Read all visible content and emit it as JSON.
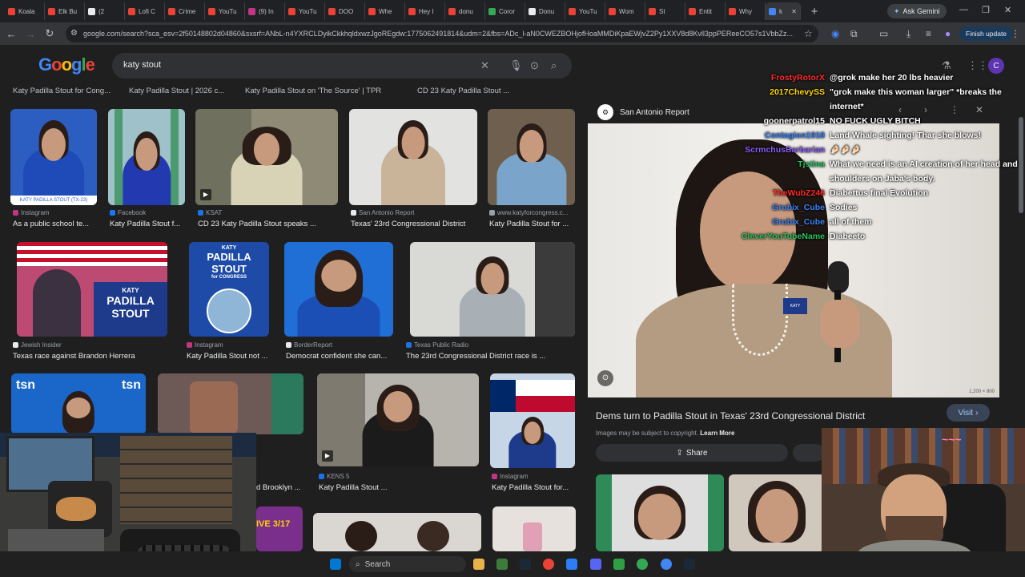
{
  "browser": {
    "tabs": [
      {
        "label": "Koala",
        "color": "#ea4335"
      },
      {
        "label": "Elk Bu",
        "color": "#ea4335"
      },
      {
        "label": "(2",
        "color": "#e8eaed"
      },
      {
        "label": "Lofi C",
        "color": "#ea4335"
      },
      {
        "label": "Crime",
        "color": "#ea4335"
      },
      {
        "label": "YouTu",
        "color": "#ea4335"
      },
      {
        "label": "(9) In",
        "color": "#c13584"
      },
      {
        "label": "YouTu",
        "color": "#ea4335"
      },
      {
        "label": "DOO",
        "color": "#ea4335"
      },
      {
        "label": "Whe",
        "color": "#ea4335"
      },
      {
        "label": "Hey I",
        "color": "#ea4335"
      },
      {
        "label": "donu",
        "color": "#ea4335"
      },
      {
        "label": "Coror",
        "color": "#34a853"
      },
      {
        "label": "Donu",
        "color": "#e8eaed"
      },
      {
        "label": "YouTu",
        "color": "#ea4335"
      },
      {
        "label": "Wom",
        "color": "#ea4335"
      },
      {
        "label": "St",
        "color": "#ea4335"
      },
      {
        "label": "Entit",
        "color": "#ea4335"
      },
      {
        "label": "Why",
        "color": "#ea4335"
      },
      {
        "label": "k",
        "color": "#4285f4"
      }
    ],
    "new_tab": "+",
    "ask_gemini": "Ask Gemini",
    "url": "google.com/search?sca_esv=2f50148802d04860&sxsrf=ANbL-n4YXRCLDyikCkkhqldxwzJgoREgdw:1775062491814&udm=2&fbs=ADc_l-aN0CWEZBOHjofHoaMMDiKpaEWjvZ2Py1XXV8d8Kvll3ppPEReeCO57s1VbbZz...",
    "finish_update": "Finish update"
  },
  "search": {
    "logo": "Google",
    "query": "katy stout",
    "chips": [
      "Katy Padilla Stout for Cong...",
      "Katy Padilla Stout | 2026 c...",
      "Katy Padilla Stout on 'The Source' | TPR",
      "CD 23 Katy Padilla Stout ..."
    ],
    "results": [
      {
        "source": "Instagram",
        "caption": "As a public school te..."
      },
      {
        "source": "Facebook",
        "caption": "Katy Padilla Stout f..."
      },
      {
        "source": "KSAT",
        "caption": "CD 23 Katy Padilla Stout speaks ..."
      },
      {
        "source": "San Antonio Report",
        "caption": "Texas' 23rd Congressional District"
      },
      {
        "source": "www.katyforcongress.c...",
        "caption": "Katy Padilla Stout for ..."
      },
      {
        "source": "Jewish Insider",
        "caption": "Texas race against Brandon Herrera"
      },
      {
        "source": "Instagram",
        "caption": "Katy Padilla Stout not ..."
      },
      {
        "source": "BorderReport",
        "caption": "Democrat confident she can..."
      },
      {
        "source": "Texas Public Radio",
        "caption": "The 23rd Congressional District race is ..."
      },
      {
        "source": "KENS 5",
        "caption": "Katy Padilla Stout ..."
      },
      {
        "source": "Instagram",
        "caption": "Katy Padilla Stout for..."
      }
    ],
    "partial_caption": "d Brooklyn ...",
    "thumb_text": {
      "katy": "KATY",
      "padilla": "PADILLA",
      "stout": "STOUT",
      "for_congress": "for CONGRESS",
      "tsn": "tsn",
      "live": "IVE 3/17"
    }
  },
  "panel": {
    "source": "San Antonio Report",
    "title": "Dems turn to Padilla Stout in Texas' 23rd Congressional District",
    "visit": "Visit",
    "copyright": "Images may be subject to copyright.",
    "learn_more": "Learn More",
    "share": "Share",
    "dims": "1,200 × 800",
    "badge_katy": "KATY"
  },
  "chat": [
    {
      "user": "FrostyRotorX",
      "color": "#ff2a2a",
      "text": "@grok make her 20 lbs heavier"
    },
    {
      "user": "2017ChevySS",
      "color": "#ffd400",
      "text": "\"grok make this woman larger\" *breaks the"
    },
    {
      "user": "",
      "color": "#ffffff",
      "text": "internet*"
    },
    {
      "user": "goonerpatrol15",
      "color": "#ffffff",
      "text": "NO FUCK UGLY BITCH"
    },
    {
      "user": "Contagion1918",
      "color": "#3b82f6",
      "text": "Land Whale sighting! Thar she blows!"
    },
    {
      "user": "ScrmchusBarbarian",
      "color": "#8b5cf6",
      "text": "🤌🏻🤌🏻🤌🏻"
    },
    {
      "user": "Tjstina",
      "color": "#22c55e",
      "text": "What we need is an AI creation of her head and"
    },
    {
      "user": "",
      "color": "#ffffff",
      "text": "shoulders on Jaba's body."
    },
    {
      "user": "TheWubZ246",
      "color": "#ff2a2a",
      "text": "Diabettus final Evolution"
    },
    {
      "user": "Grubix_Cube",
      "color": "#3b82f6",
      "text": "Sodies"
    },
    {
      "user": "Grubix_Cube",
      "color": "#3b82f6",
      "text": "all of them"
    },
    {
      "user": "CleverYouTubeName",
      "color": "#22c55e",
      "text": "Diabeeto"
    }
  ],
  "taskbar": {
    "search": "Search"
  }
}
